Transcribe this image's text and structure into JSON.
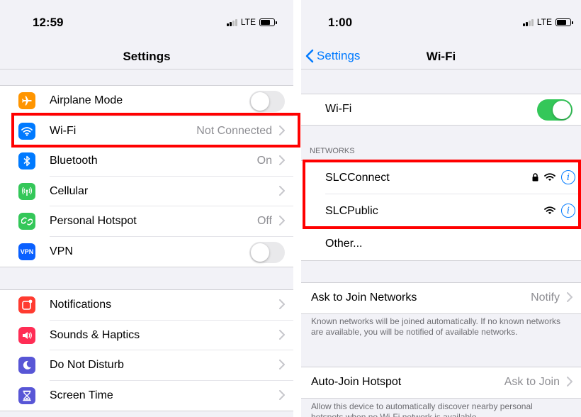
{
  "left": {
    "time": "12:59",
    "network_type": "LTE",
    "title": "Settings",
    "group1": [
      {
        "key": "airplane",
        "label": "Airplane Mode",
        "detail": "",
        "icon": "airplane-icon",
        "color": "#ff9500",
        "control": "toggle"
      },
      {
        "key": "wifi",
        "label": "Wi-Fi",
        "detail": "Not Connected",
        "icon": "wifi-icon",
        "color": "#007aff",
        "control": "chevron"
      },
      {
        "key": "bluetooth",
        "label": "Bluetooth",
        "detail": "On",
        "icon": "bluetooth-icon",
        "color": "#007aff",
        "control": "chevron"
      },
      {
        "key": "cellular",
        "label": "Cellular",
        "detail": "",
        "icon": "cellular-icon",
        "color": "#34c759",
        "control": "chevron"
      },
      {
        "key": "hotspot",
        "label": "Personal Hotspot",
        "detail": "Off",
        "icon": "hotspot-icon",
        "color": "#34c759",
        "control": "chevron"
      },
      {
        "key": "vpn",
        "label": "VPN",
        "detail": "",
        "icon": "vpn-icon",
        "icon_text": "VPN",
        "color": "#0a60ff",
        "control": "toggle"
      }
    ],
    "group2": [
      {
        "key": "notifications",
        "label": "Notifications",
        "icon": "notifications-icon",
        "color": "#ff3b30"
      },
      {
        "key": "sounds",
        "label": "Sounds & Haptics",
        "icon": "speaker-icon",
        "color": "#ff2d55"
      },
      {
        "key": "dnd",
        "label": "Do Not Disturb",
        "icon": "moon-icon",
        "color": "#5856d6"
      },
      {
        "key": "screentime",
        "label": "Screen Time",
        "icon": "hourglass-icon",
        "color": "#5856d6"
      }
    ]
  },
  "right": {
    "time": "1:00",
    "network_type": "LTE",
    "back_label": "Settings",
    "title": "Wi-Fi",
    "wifi_label": "Wi-Fi",
    "wifi_on": true,
    "networks_header": "NETWORKS",
    "networks": [
      {
        "name": "SLCConnect",
        "locked": true
      },
      {
        "name": "SLCPublic",
        "locked": false
      }
    ],
    "other_label": "Other...",
    "ask_join_label": "Ask to Join Networks",
    "ask_join_value": "Notify",
    "ask_join_note": "Known networks will be joined automatically. If no known networks are available, you will be notified of available networks.",
    "auto_join_label": "Auto-Join Hotspot",
    "auto_join_value": "Ask to Join",
    "auto_join_note": "Allow this device to automatically discover nearby personal hotspots when no Wi-Fi network is available."
  },
  "colors": {
    "highlight": "#ff0000",
    "accent": "#007aff",
    "toggle_on": "#34c759"
  }
}
